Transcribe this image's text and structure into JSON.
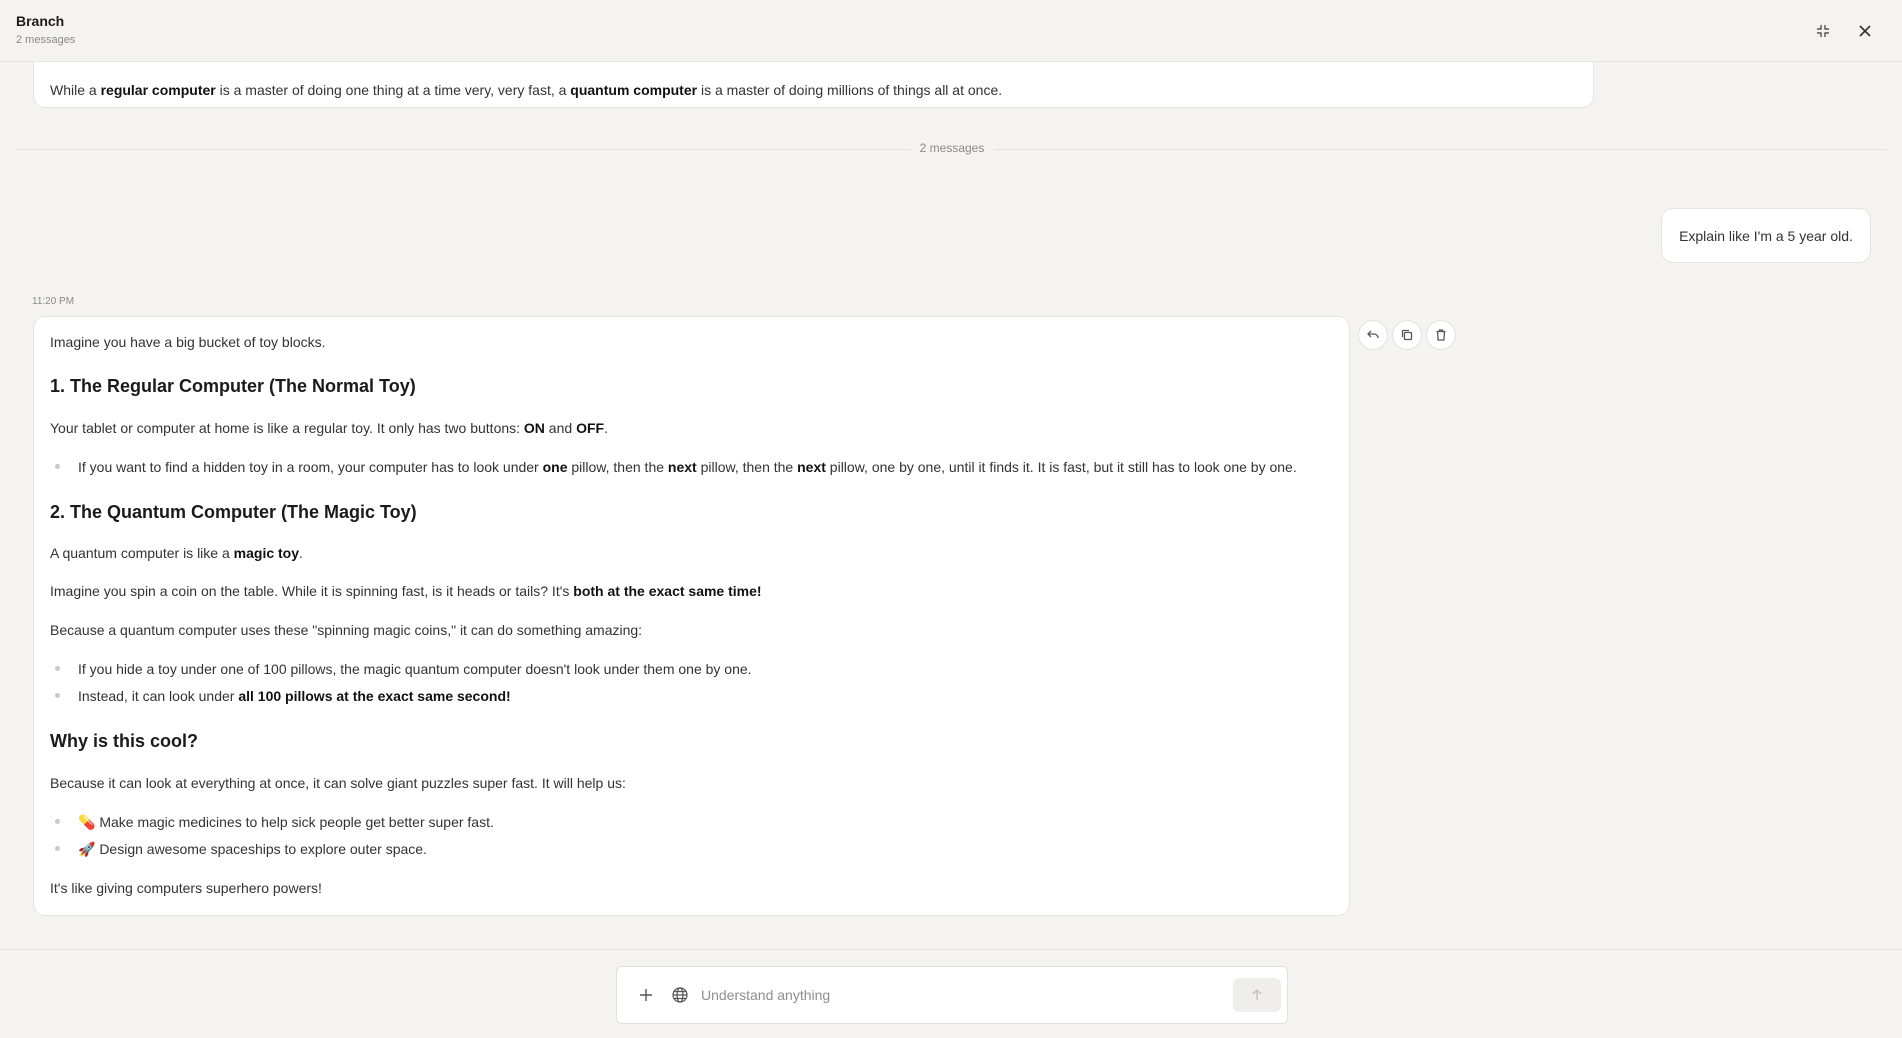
{
  "header": {
    "title": "Branch",
    "subtitle": "2 messages"
  },
  "previous_message": {
    "parts": [
      "While a ",
      "regular computer",
      " is a master of doing one thing at a time very, very fast, a ",
      "quantum computer",
      " is a master of doing millions of things all at once."
    ]
  },
  "divider_label": "2 messages",
  "user_message": "Explain like I'm a 5 year old.",
  "reply": {
    "timestamp": "11:20 PM",
    "intro": "Imagine you have a big bucket of toy blocks.",
    "h1": "1. The Regular Computer (The Normal Toy)",
    "p1": [
      "Your tablet or computer at home is like a regular toy. It only has two buttons: ",
      "ON",
      " and ",
      "OFF",
      "."
    ],
    "b1": [
      "If you want to find a hidden toy in a room, your computer has to look under ",
      "one",
      " pillow, then the ",
      "next",
      " pillow, then the ",
      "next",
      " pillow, one by one, until it finds it. It is fast, but it still has to look one by one."
    ],
    "h2": "2. The Quantum Computer (The Magic Toy)",
    "p2": [
      "A quantum computer is like a ",
      "magic toy",
      "."
    ],
    "p3": [
      "Imagine you spin a coin on the table. While it is spinning fast, is it heads or tails? It's ",
      "both at the exact same time!"
    ],
    "p4": "Because a quantum computer uses these \"spinning magic coins,\" it can do something amazing:",
    "b2": "If you hide a toy under one of 100 pillows, the magic quantum computer doesn't look under them one by one.",
    "b3": [
      "Instead, it can look under ",
      "all 100 pillows at the exact same second!"
    ],
    "h3": "Why is this cool?",
    "p5": "Because it can look at everything at once, it can solve giant puzzles super fast. It will help us:",
    "b4": "💊 Make magic medicines to help sick people get better super fast.",
    "b5": "🚀 Design awesome spaceships to explore outer space.",
    "p6": "It's like giving computers superhero powers!"
  },
  "composer": {
    "placeholder": "Understand anything"
  },
  "colors": {
    "background": "#f4f3ef",
    "card": "#ffffff",
    "border": "#e6e4de"
  },
  "icons": [
    "minimize-icon",
    "close-icon",
    "reply-icon",
    "copy-icon",
    "trash-icon",
    "plus-icon",
    "globe-icon",
    "arrow-up-icon"
  ]
}
